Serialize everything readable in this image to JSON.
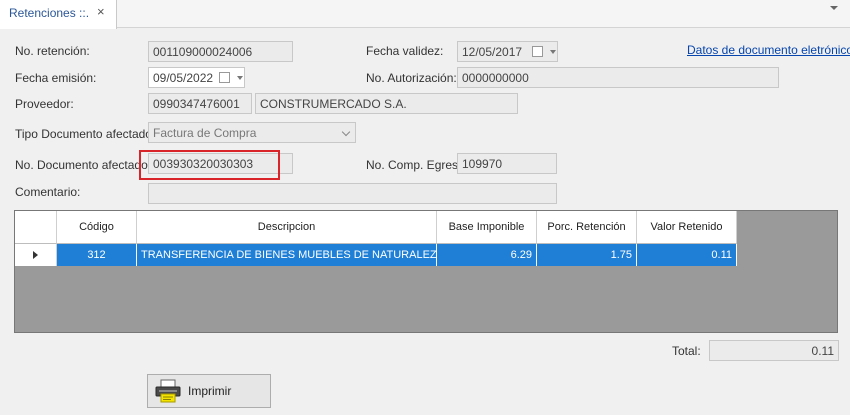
{
  "tab": {
    "title": "Retenciones ::.",
    "close": "×"
  },
  "form": {
    "no_retencion": {
      "label": "No. retención:",
      "value": "001109000024006"
    },
    "fecha_validez": {
      "label": "Fecha validez:",
      "value": "12/05/2017"
    },
    "datos_link": "Datos de documento eletrónico",
    "fecha_emision": {
      "label": "Fecha emisión:",
      "value": "09/05/2022"
    },
    "no_autorizacion": {
      "label": "No. Autorización:",
      "value": "0000000000"
    },
    "proveedor": {
      "label": "Proveedor:",
      "ruc": "0990347476001",
      "name": "CONSTRUMERCADO S.A."
    },
    "tipo_doc": {
      "label": "Tipo Documento afectado:",
      "value": "Factura de Compra"
    },
    "no_doc_afectado": {
      "label": "No. Documento afectado:",
      "value": "003930320030303"
    },
    "no_comp_egreso": {
      "label": "No. Comp. Egreso:",
      "value": "109970"
    },
    "comentario": {
      "label": "Comentario:",
      "value": ""
    }
  },
  "grid": {
    "headers": [
      "Código",
      "Descripcion",
      "Base Imponible",
      "Porc. Retención",
      "Valor Retenido"
    ],
    "rows": [
      {
        "codigo": "312",
        "descripcion": "TRANSFERENCIA DE BIENES MUEBLES DE NATURALEZA C...",
        "base": "6.29",
        "porc": "1.75",
        "valor": "0.11"
      }
    ]
  },
  "total": {
    "label": "Total:",
    "value": "0.11"
  },
  "print_button": {
    "label": "Imprimir"
  },
  "colors": {
    "selection": "#1f7fd6",
    "grid_bg": "#9a9a9a",
    "highlight": "#d9252a",
    "link": "#0645ad"
  }
}
